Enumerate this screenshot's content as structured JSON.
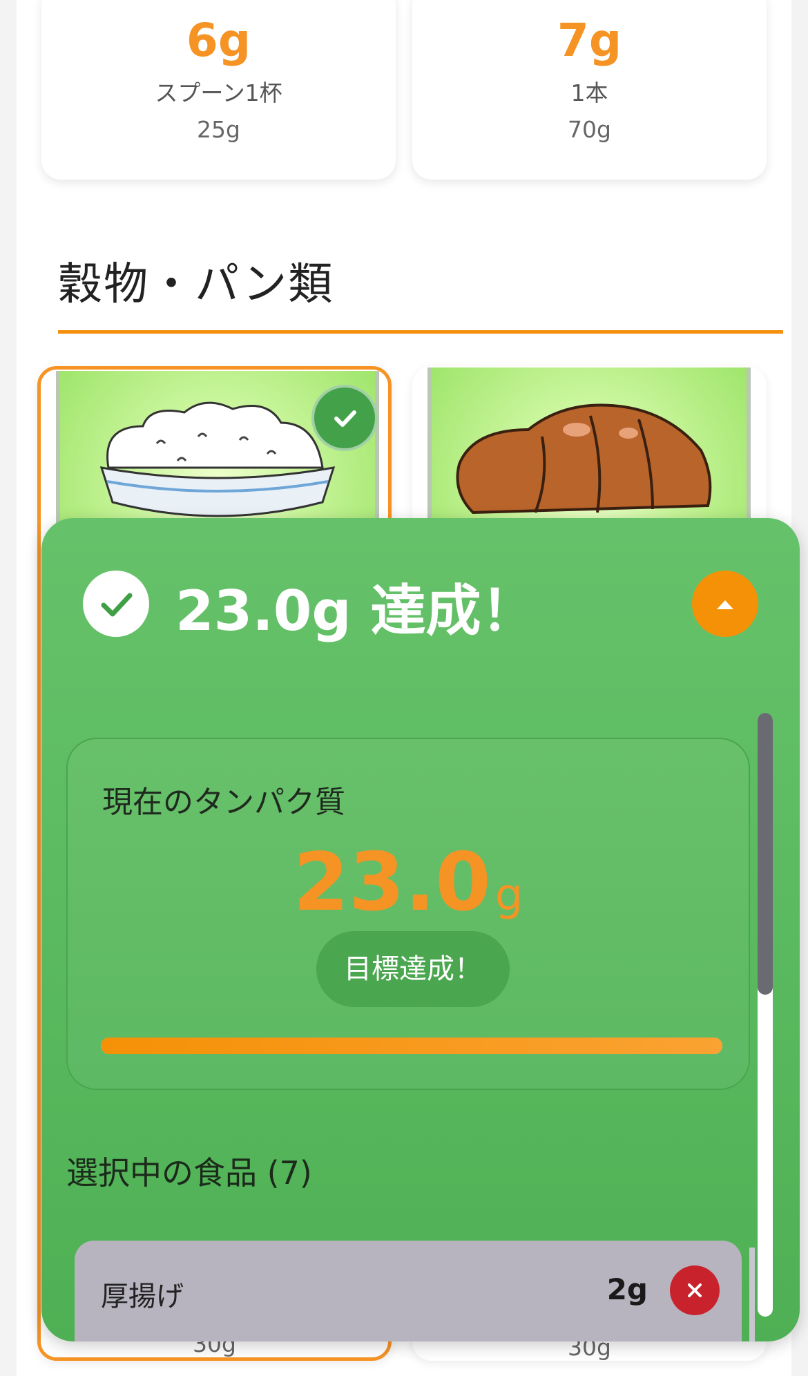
{
  "top_cards": [
    {
      "protein": "6g",
      "unit": "スプーン1杯",
      "grams": "25g"
    },
    {
      "protein": "7g",
      "unit": "1本",
      "grams": "70g"
    }
  ],
  "section": {
    "title": "穀物・パン類"
  },
  "grain_cards": [
    {
      "name": "rice",
      "selected": true,
      "grams_partial": "30g"
    },
    {
      "name": "croissant",
      "selected": false,
      "grams_partial": "30g"
    }
  ],
  "panel": {
    "header_title": "23.0g 達成！",
    "protein_card": {
      "label": "現在のタンパク質",
      "value": "23.0",
      "unit": "g",
      "goal_badge": "目標達成！",
      "progress_fraction": 1.0
    },
    "selected_title": "選択中の食品 (7)",
    "items": [
      {
        "name": "厚揚げ",
        "protein": "2g"
      }
    ]
  },
  "colors": {
    "accent_orange": "#f59324",
    "panel_green": "#5cb85f",
    "remove_red": "#c8232c"
  }
}
